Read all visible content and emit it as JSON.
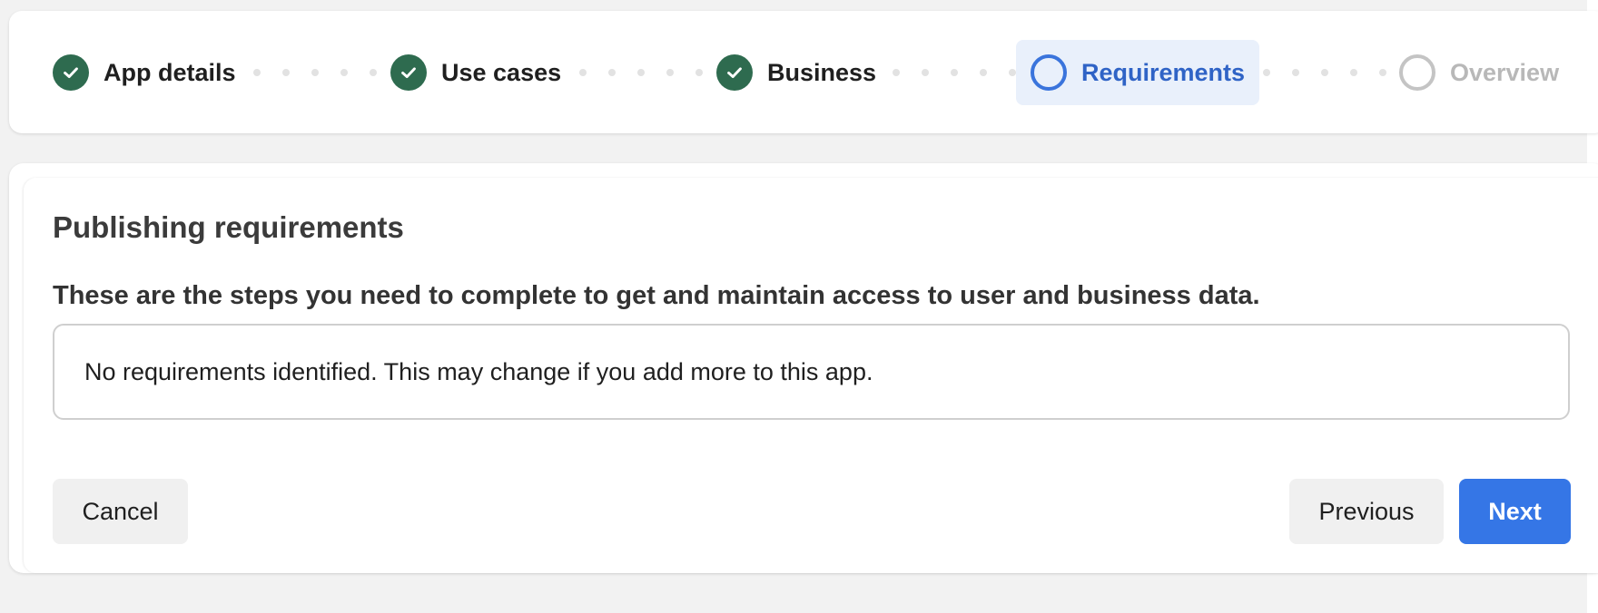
{
  "stepper": {
    "steps": [
      {
        "label": "App details",
        "state": "done"
      },
      {
        "label": "Use cases",
        "state": "done"
      },
      {
        "label": "Business",
        "state": "done"
      },
      {
        "label": "Requirements",
        "state": "active"
      },
      {
        "label": "Overview",
        "state": "future"
      }
    ],
    "colors": {
      "done": "#2e6b4f",
      "active": "#3a74dc",
      "active_bg": "#e9f0fb",
      "future": "#c4c4c4"
    }
  },
  "main": {
    "title": "Publishing requirements",
    "subtitle": "These are the steps you need to complete to get and maintain access to user and business data.",
    "notice": "No requirements identified. This may change if you add more to this app."
  },
  "actions": {
    "cancel_label": "Cancel",
    "previous_label": "Previous",
    "next_label": "Next",
    "primary_color": "#3576e6"
  }
}
